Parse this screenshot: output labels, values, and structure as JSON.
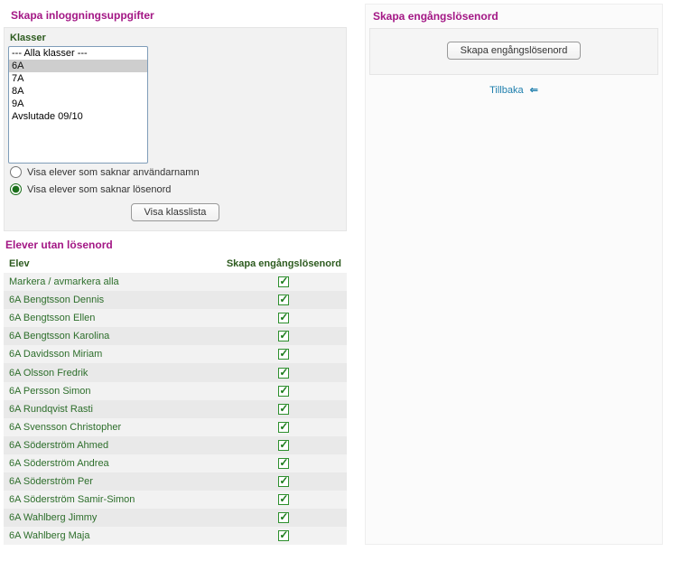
{
  "left": {
    "title": "Skapa inloggningsuppgifter",
    "classes_label": "Klasser",
    "classes": [
      "--- Alla klasser ---",
      "6A",
      "7A",
      "8A",
      "9A",
      "Avslutade 09/10"
    ],
    "selected_class_index": 1,
    "radio1": "Visa elever som saknar användarnamn",
    "radio2": "Visa elever som saknar lösenord",
    "radio_selected": 2,
    "show_list_btn": "Visa klasslista",
    "students_title": "Elever utan lösenord",
    "col_student": "Elev",
    "col_action": "Skapa engångslösenord",
    "toggle_all": "Markera / avmarkera alla",
    "students": [
      "6A Bengtsson Dennis",
      "6A Bengtsson Ellen",
      "6A Bengtsson Karolina",
      "6A Davidsson Miriam",
      "6A Olsson Fredrik",
      "6A Persson Simon",
      "6A Rundqvist Rasti",
      "6A Svensson Christopher",
      "6A Söderström Ahmed",
      "6A Söderström Andrea",
      "6A Söderström Per",
      "6A Söderström Samir-Simon",
      "6A Wahlberg Jimmy",
      "6A Wahlberg Maja"
    ]
  },
  "right": {
    "title": "Skapa engångslösenord",
    "button": "Skapa engångslösenord",
    "back": "Tillbaka"
  }
}
